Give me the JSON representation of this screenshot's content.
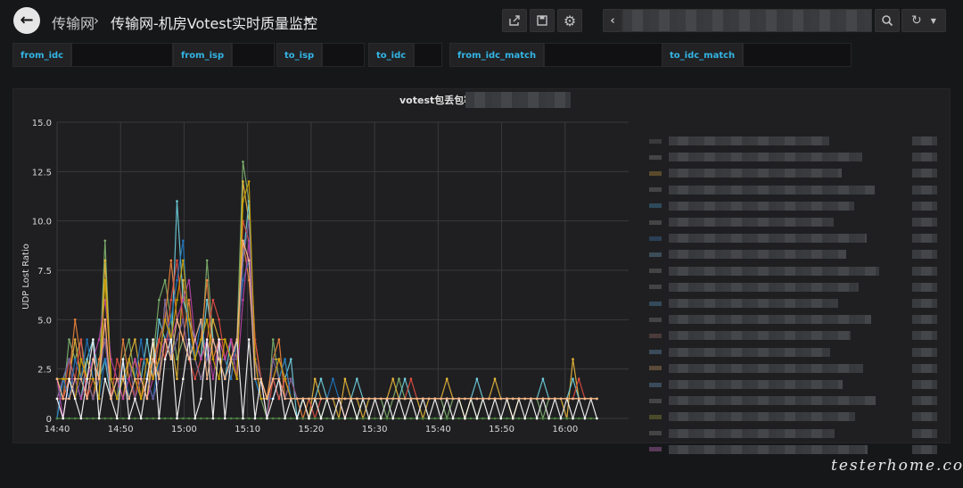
{
  "header": {
    "breadcrumb_parent": "传输网",
    "separator": "›",
    "dashboard_title": "传输网-机房Votest实时质量监控"
  },
  "toolbar": {
    "share_icon": "share-icon",
    "save_icon": "save-icon",
    "settings_icon": "gear-icon",
    "prev_icon": "chevron-left-icon",
    "zoom_icon": "search-icon",
    "refresh_icon": "refresh-icon"
  },
  "variables": [
    {
      "label": "from_idc"
    },
    {
      "label": "from_isp"
    },
    {
      "label": "to_isp"
    },
    {
      "label": "to_idc"
    },
    {
      "label": "from_idc_match"
    },
    {
      "label": "to_idc_match"
    }
  ],
  "panel": {
    "title": "votest包丢包率"
  },
  "chart_data": {
    "type": "line",
    "title": "votest包丢包率",
    "ylabel": "UDP Lost Ratio",
    "xlabel": "",
    "x_ticks": [
      "14:40",
      "14:50",
      "15:00",
      "15:10",
      "15:20",
      "15:30",
      "15:40",
      "15:50",
      "16:00"
    ],
    "y_ticks": [
      "0",
      "2.5",
      "5.0",
      "7.5",
      "10.0",
      "12.5",
      "15.0"
    ],
    "ylim": [
      0,
      15
    ],
    "x_range": [
      "14:40",
      "16:10"
    ],
    "grid": true,
    "legend_placement": "right",
    "colors": [
      "#7eb26d",
      "#eab839",
      "#6ed0e0",
      "#ef843c",
      "#e24d42",
      "#1f78c1",
      "#ba43a9",
      "#705da0",
      "#508642",
      "#cca300",
      "#ffffff",
      "#f9ba8f"
    ],
    "series": [
      {
        "values": [
          2,
          1,
          4,
          3,
          4,
          2,
          1,
          2,
          9,
          2,
          1,
          3,
          4,
          2,
          1,
          2,
          3,
          6,
          7,
          5,
          3,
          4,
          3,
          4,
          3,
          8,
          4,
          3,
          2,
          3,
          4,
          13,
          11,
          3,
          1,
          0,
          4,
          2,
          3,
          1,
          0,
          1,
          1,
          1,
          0,
          1,
          1,
          1,
          1,
          1,
          0,
          1,
          1,
          1,
          1,
          0,
          1,
          2,
          1,
          1,
          1,
          1,
          1,
          1,
          1,
          0,
          1,
          1,
          1,
          1,
          0,
          1,
          1,
          1,
          1,
          1,
          1,
          1,
          1,
          1,
          1,
          0,
          1,
          1,
          1,
          1,
          1,
          1,
          1,
          1,
          1
        ]
      },
      {
        "values": [
          1,
          2,
          2,
          4,
          2,
          3,
          2,
          1,
          8,
          2,
          2,
          1,
          3,
          4,
          2,
          1,
          4,
          2,
          6,
          4,
          2,
          7,
          4,
          3,
          2,
          3,
          5,
          4,
          4,
          3,
          2,
          12,
          10,
          4,
          2,
          1,
          3,
          3,
          2,
          1,
          1,
          1,
          0,
          2,
          1,
          1,
          1,
          0,
          2,
          1,
          1,
          0,
          1,
          1,
          1,
          1,
          2,
          1,
          1,
          1,
          1,
          0,
          1,
          1,
          1,
          2,
          1,
          1,
          0,
          1,
          1,
          1,
          1,
          2,
          1,
          1,
          0,
          1,
          1,
          1,
          1,
          1,
          1,
          1,
          1,
          0,
          3,
          1,
          1,
          1,
          1
        ]
      },
      {
        "values": [
          0,
          2,
          3,
          2,
          1,
          3,
          4,
          2,
          3,
          1,
          2,
          2,
          3,
          2,
          2,
          4,
          2,
          5,
          4,
          3,
          11,
          6,
          5,
          4,
          3,
          6,
          4,
          3,
          2,
          4,
          3,
          8,
          11,
          2,
          1,
          1,
          2,
          1,
          2,
          3,
          0,
          1,
          1,
          1,
          2,
          1,
          1,
          1,
          1,
          1,
          2,
          1,
          1,
          1,
          1,
          1,
          1,
          1,
          2,
          1,
          1,
          1,
          1,
          1,
          1,
          1,
          1,
          1,
          1,
          1,
          2,
          1,
          1,
          1,
          1,
          1,
          1,
          1,
          1,
          1,
          1,
          2,
          1,
          1,
          1,
          1,
          2,
          1,
          1,
          1,
          1
        ]
      },
      {
        "values": [
          2,
          1,
          2,
          5,
          3,
          2,
          1,
          3,
          4,
          2,
          1,
          4,
          2,
          3,
          1,
          2,
          3,
          4,
          5,
          8,
          5,
          4,
          6,
          3,
          4,
          7,
          3,
          4,
          3,
          2,
          4,
          9,
          7,
          3,
          2,
          1,
          3,
          4,
          1,
          2,
          1,
          0,
          1,
          1,
          1,
          1,
          1,
          1,
          1,
          1,
          1,
          1,
          1,
          1,
          1,
          1,
          1,
          1,
          1,
          1,
          1,
          1,
          1,
          1,
          1,
          1,
          1,
          1,
          1,
          1,
          1,
          1,
          1,
          1,
          1,
          1,
          1,
          1,
          1,
          1,
          1,
          1,
          1,
          1,
          1,
          1,
          1,
          1,
          1,
          1,
          1
        ]
      },
      {
        "values": [
          1,
          1,
          3,
          2,
          4,
          1,
          2,
          2,
          5,
          1,
          3,
          2,
          2,
          1,
          3,
          3,
          2,
          4,
          3,
          6,
          8,
          5,
          3,
          2,
          3,
          4,
          6,
          5,
          3,
          4,
          3,
          10,
          9,
          4,
          2,
          0,
          2,
          1,
          2,
          2,
          1,
          1,
          1,
          0,
          1,
          1,
          1,
          1,
          0,
          1,
          1,
          1,
          1,
          1,
          1,
          1,
          1,
          1,
          1,
          2,
          1,
          1,
          1,
          1,
          1,
          1,
          1,
          1,
          1,
          1,
          1,
          1,
          1,
          1,
          1,
          1,
          1,
          1,
          1,
          1,
          1,
          1,
          1,
          1,
          1,
          1,
          1,
          2,
          1,
          1,
          1
        ]
      },
      {
        "values": [
          0,
          2,
          1,
          3,
          2,
          4,
          2,
          1,
          3,
          2,
          1,
          3,
          1,
          2,
          4,
          2,
          1,
          3,
          4,
          5,
          7,
          9,
          4,
          3,
          5,
          3,
          4,
          3,
          3,
          2,
          4,
          7,
          8,
          2,
          1,
          1,
          1,
          2,
          3,
          1,
          1,
          1,
          1,
          1,
          1,
          1,
          2,
          1,
          1,
          1,
          1,
          1,
          1,
          1,
          1,
          1,
          1,
          1,
          1,
          1,
          1,
          1,
          1,
          1,
          1,
          1,
          1,
          1,
          1,
          1,
          1,
          1,
          1,
          1,
          1,
          1,
          1,
          1,
          1,
          1,
          1,
          1,
          1,
          1,
          1,
          1,
          1,
          1,
          1,
          1,
          1
        ]
      },
      {
        "values": [
          2,
          0,
          2,
          2,
          1,
          2,
          3,
          4,
          6,
          3,
          2,
          1,
          2,
          3,
          2,
          1,
          2,
          3,
          4,
          4,
          5,
          6,
          7,
          4,
          3,
          4,
          2,
          4,
          3,
          4,
          2,
          6,
          9,
          3,
          1,
          1,
          2,
          3,
          2,
          1,
          1,
          1,
          1,
          1,
          1,
          1,
          1,
          1,
          1,
          1,
          1,
          1,
          1,
          1,
          1,
          1,
          1,
          1,
          1,
          1,
          1,
          1,
          1,
          1,
          1,
          1,
          1,
          1,
          1,
          1,
          1,
          1,
          1,
          1,
          1,
          1,
          1,
          1,
          1,
          1,
          1,
          1,
          1,
          1,
          1,
          1,
          1,
          1,
          1,
          1,
          1
        ]
      },
      {
        "values": [
          1,
          2,
          3,
          1,
          2,
          2,
          1,
          2,
          4,
          1,
          2,
          2,
          3,
          1,
          2,
          2,
          1,
          2,
          6,
          3,
          4,
          5,
          3,
          3,
          2,
          3,
          4,
          3,
          2,
          3,
          3,
          8,
          10,
          3,
          2,
          0,
          3,
          2,
          1,
          2,
          1,
          1,
          1,
          1,
          1,
          1,
          1,
          1,
          1,
          1,
          1,
          1,
          1,
          1,
          1,
          1,
          1,
          1,
          1,
          1,
          1,
          1,
          1,
          1,
          1,
          1,
          1,
          1,
          1,
          1,
          1,
          1,
          1,
          1,
          1,
          1,
          1,
          1,
          1,
          1,
          1,
          1,
          1,
          1,
          1,
          1,
          1,
          1,
          1,
          1,
          1
        ]
      },
      {
        "values": [
          0,
          0,
          0,
          0,
          0,
          0,
          0,
          0,
          0,
          0,
          0,
          0,
          0,
          0,
          0,
          0,
          0,
          0,
          0,
          0,
          0,
          0,
          0,
          0,
          0,
          0,
          0,
          0,
          0,
          0,
          0,
          0,
          0,
          0,
          0,
          0,
          0,
          0,
          0,
          0,
          0,
          0,
          0,
          0,
          0,
          0,
          0,
          0,
          0,
          0,
          0,
          0,
          0,
          0,
          0,
          0,
          0,
          0,
          0,
          0,
          0,
          0,
          0,
          0,
          0,
          0,
          0,
          0,
          0,
          0,
          0,
          0,
          0,
          0,
          0,
          0,
          0,
          0,
          0,
          0,
          0,
          0,
          0,
          0,
          0,
          0,
          0,
          0,
          0,
          0,
          0
        ]
      },
      {
        "values": [
          2,
          2,
          2,
          1,
          3,
          2,
          2,
          1,
          7,
          2,
          1,
          2,
          3,
          2,
          1,
          3,
          2,
          3,
          5,
          4,
          6,
          8,
          5,
          3,
          4,
          5,
          3,
          2,
          4,
          3,
          2,
          11,
          12,
          3,
          1,
          1,
          2,
          3,
          2,
          1,
          1,
          1,
          1,
          1,
          1,
          1,
          1,
          1,
          1,
          1,
          1,
          1,
          1,
          1,
          1,
          1,
          1,
          1,
          1,
          1,
          1,
          1,
          1,
          1,
          1,
          1,
          1,
          1,
          1,
          1,
          1,
          1,
          1,
          1,
          1,
          1,
          1,
          1,
          1,
          1,
          1,
          1,
          1,
          1,
          1,
          1,
          1,
          1,
          1,
          1,
          1
        ]
      },
      {
        "values": [
          1,
          0,
          2,
          1,
          0,
          2,
          4,
          0,
          2,
          1,
          0,
          3,
          0,
          1,
          0,
          2,
          4,
          0,
          3,
          4,
          0,
          2,
          4,
          0,
          1,
          4,
          0,
          4,
          0,
          3,
          4,
          0,
          4,
          0,
          2,
          0,
          1,
          2,
          0,
          1,
          0,
          1,
          0,
          1,
          0,
          1,
          0,
          1,
          0,
          1,
          0,
          1,
          0,
          1,
          0,
          1,
          0,
          1,
          0,
          1,
          0,
          1,
          0,
          1,
          0,
          1,
          0,
          1,
          0,
          1,
          0,
          1,
          0,
          1,
          0,
          1,
          0,
          1,
          0,
          1,
          0,
          1,
          0,
          1,
          0,
          1,
          0,
          1,
          0,
          1,
          0
        ]
      },
      {
        "values": [
          2,
          1,
          1,
          2,
          2,
          1,
          3,
          2,
          5,
          1,
          2,
          2,
          1,
          2,
          2,
          1,
          3,
          2,
          4,
          3,
          5,
          4,
          3,
          4,
          5,
          2,
          4,
          3,
          2,
          3,
          4,
          9,
          8,
          2,
          2,
          1,
          2,
          2,
          1,
          1,
          1,
          1,
          1,
          1,
          1,
          1,
          1,
          1,
          1,
          1,
          1,
          1,
          1,
          1,
          1,
          1,
          1,
          1,
          1,
          1,
          1,
          1,
          1,
          1,
          1,
          1,
          1,
          1,
          1,
          1,
          1,
          1,
          1,
          1,
          1,
          1,
          1,
          1,
          1,
          1,
          1,
          1,
          1,
          1,
          1,
          1,
          1,
          1,
          1,
          1,
          1
        ]
      }
    ]
  },
  "watermark": "testerhome.com"
}
